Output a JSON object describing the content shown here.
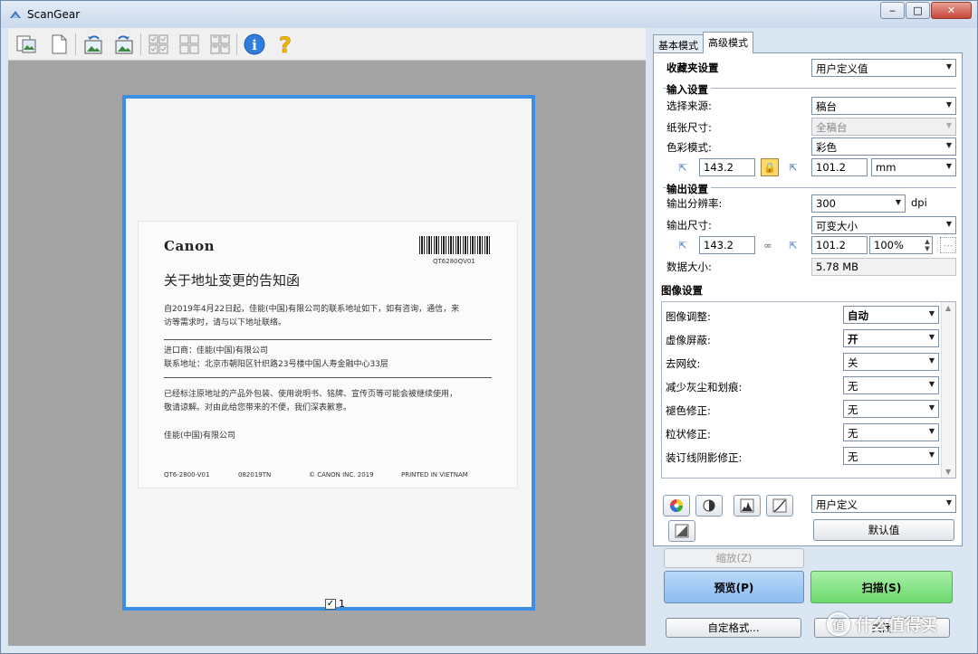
{
  "window": {
    "title": "ScanGear",
    "minimize": "‒",
    "maximize": "□",
    "close": "✕"
  },
  "toolbar": {
    "icons": [
      "thumbnail-view-icon",
      "whole-image-view-icon",
      "rotate-left-icon",
      "rotate-right-icon",
      "auto-crop-icon",
      "select-all-frames-icon",
      "clear-frames-icon",
      "info-icon",
      "help-icon"
    ],
    "info_glyph": "i",
    "help_glyph": "?"
  },
  "preview": {
    "page_checked": true,
    "page_number": "1",
    "document": {
      "logo": "Canon",
      "code": "QT6280QV01",
      "headline": "关于地址变更的告知函",
      "para1_line1": "自2019年4月22日起，佳能(中国)有限公司的联系地址如下，如有咨询，通信，来",
      "para1_line2": "访等需求时，请与以下地址联络。",
      "importer": "进口商：佳能(中国)有限公司",
      "address": "联系地址：北京市朝阳区针织路23号楼中国人寿金融中心33层",
      "para2_line1": "已经标注原地址的产品外包装、使用说明书、铭牌、宣传页等可能会被继续使用，",
      "para2_line2": "敬请谅解。对由此给您带来的不便，我们深表歉意。",
      "signature": "佳能(中国)有限公司",
      "footer": [
        "QT6-2800-V01",
        "082019TN",
        "© CANON INC. 2019",
        "PRINTED IN VIETNAM"
      ]
    }
  },
  "tabs": [
    "基本模式",
    "高级模式"
  ],
  "favorites": {
    "label": "收藏夹设置",
    "value": "用户定义值"
  },
  "input": {
    "heading": "输入设置",
    "source_label": "选择来源:",
    "source_value": "稿台",
    "paper_label": "纸张尺寸:",
    "paper_value": "全稿台",
    "color_label": "色彩模式:",
    "color_value": "彩色",
    "width": "143.2",
    "height": "101.2",
    "unit": "mm"
  },
  "output": {
    "heading": "输出设置",
    "res_label": "输出分辨率:",
    "res_value": "300",
    "res_unit": "dpi",
    "size_label": "输出尺寸:",
    "size_value": "可变大小",
    "width": "143.2",
    "height": "101.2",
    "scale": "100%",
    "data_label": "数据大小:",
    "data_value": "5.78 MB"
  },
  "image_settings": {
    "heading": "图像设置",
    "rows": [
      {
        "label": "图像调整:",
        "value": "自动"
      },
      {
        "label": "虚像屏蔽:",
        "value": "开"
      },
      {
        "label": "去网纹:",
        "value": "关"
      },
      {
        "label": "减少灰尘和划痕:",
        "value": "无"
      },
      {
        "label": "褪色修正:",
        "value": "无"
      },
      {
        "label": "粒状修正:",
        "value": "无"
      },
      {
        "label": "装订线阴影修正:",
        "value": "无"
      }
    ]
  },
  "adjust": {
    "preset": "用户定义",
    "defaults": "默认值"
  },
  "buttons": {
    "zoom": "缩放(Z)",
    "preview": "预览(P)",
    "scan": "扫描(S)",
    "custom": "自定格式...",
    "close": "关闭"
  },
  "watermark": {
    "glyph": "值",
    "text": "什么值得买"
  }
}
